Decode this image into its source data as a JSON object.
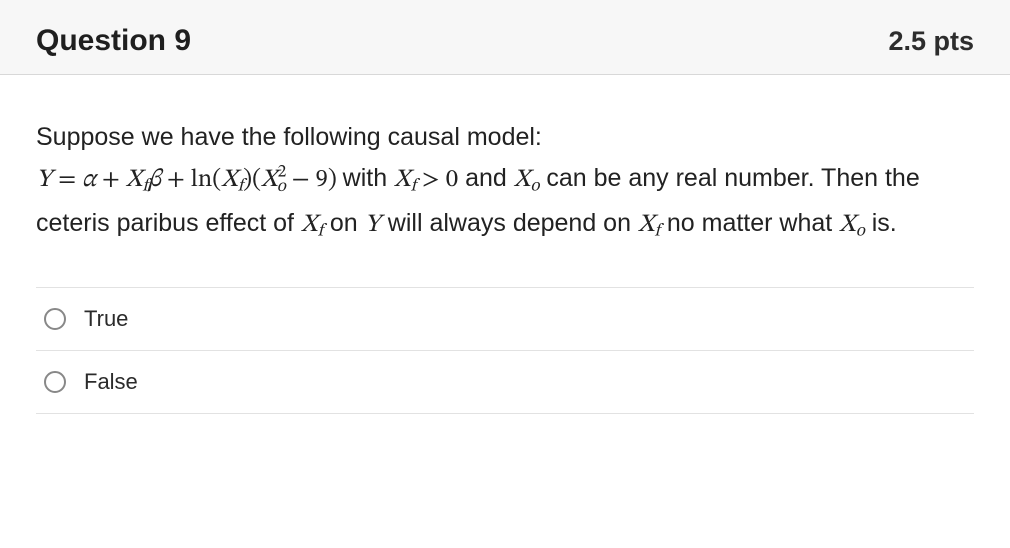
{
  "header": {
    "title": "Question 9",
    "points": "2.5 pts"
  },
  "prompt": {
    "intro": "Suppose we have the following causal model:",
    "eq_Y": "Y",
    "eq_eq": " = ",
    "eq_alpha": "α",
    "eq_plus1": " + ",
    "eq_Xf1": "X",
    "eq_f_sub": "f",
    "eq_beta": "β",
    "eq_plus2": " + ",
    "eq_ln": "ln",
    "eq_lp1": "(",
    "eq_Xf2": "X",
    "eq_rp1": ")(",
    "eq_Xo1": "X",
    "eq_o_sub": "o",
    "eq_sq": "2",
    "eq_minus9": " − 9)",
    "with_text": " with ",
    "gt0": " > 0",
    "and_text": " and ",
    "tail1": " can be any real number.  Then the ceteris paribus effect of ",
    "on_text": " on ",
    "eq_Y2": "Y",
    "tail2": " will always depend on ",
    "tail3": " no matter what ",
    "tail4": " is."
  },
  "options": [
    {
      "label": "True"
    },
    {
      "label": "False"
    }
  ]
}
